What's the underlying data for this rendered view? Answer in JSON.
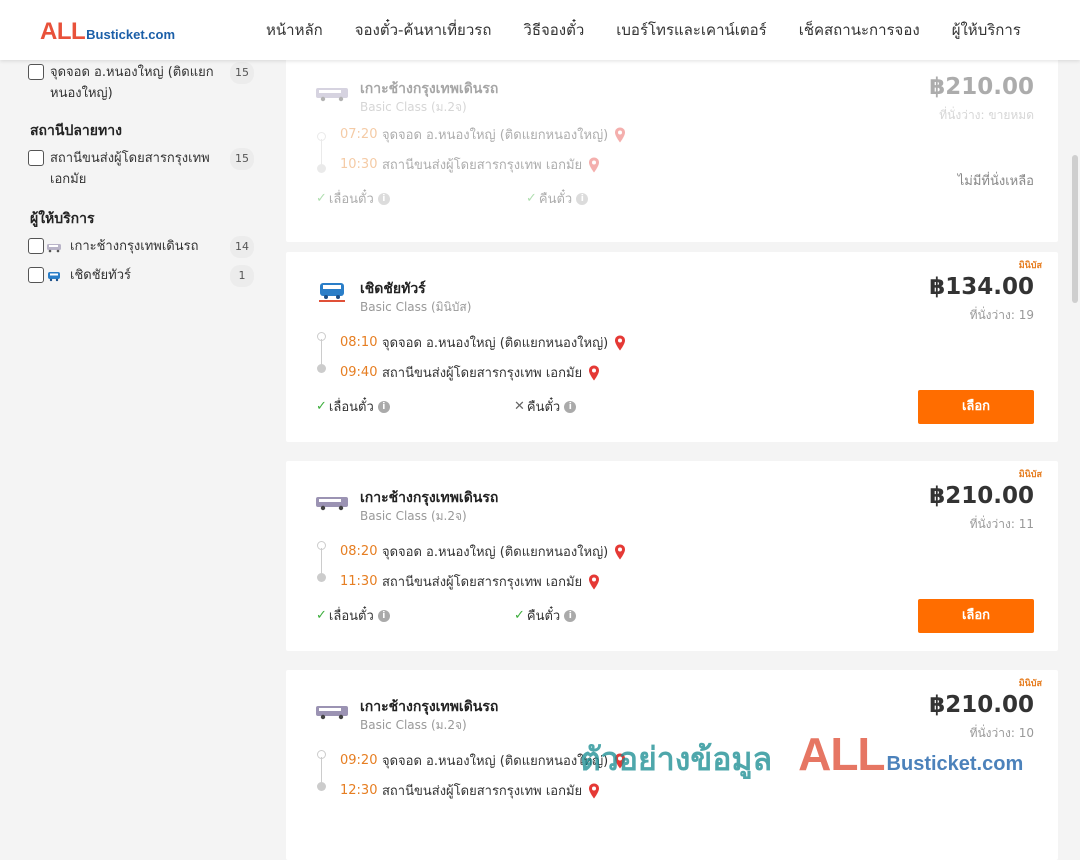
{
  "header": {
    "logo_all": "ALL",
    "logo_rest": "Busticket.com",
    "nav": [
      "หน้าหลัก",
      "จองตั๋ว-ค้นหาเที่ยวรถ",
      "วิธีจองตั๋ว",
      "เบอร์โทรและเคาน์เตอร์",
      "เช็คสถานะการจอง",
      "ผู้ให้บริการ"
    ]
  },
  "sidebar": {
    "origin_items": [
      {
        "label": "จุดจอด อ.หนองใหญ่ (ติดแยกหนองใหญ่)",
        "count": "15"
      }
    ],
    "dest_title": "สถานีปลายทาง",
    "dest_items": [
      {
        "label": "สถานีขนส่งผู้โดยสารกรุงเทพ เอกมัย",
        "count": "15"
      }
    ],
    "operator_title": "ผู้ให้บริการ",
    "operator_items": [
      {
        "label": "เกาะช้างกรุงเทพเดินรถ",
        "count": "14"
      },
      {
        "label": "เชิดชัยทัวร์",
        "count": "1"
      }
    ]
  },
  "cards": [
    {
      "operator": "เกาะช้างกรุงเทพเดินรถ",
      "class": "Basic Class (ม.2จ)",
      "price": "฿210.00",
      "seats": "ที่นั่งว่าง: ขายหมด",
      "dep_time": "07:20",
      "dep_place": "จุดจอด อ.หนองใหญ่ (ติดแยกหนองใหญ่)",
      "arr_time": "10:30",
      "arr_place": "สถานีขนส่งผู้โดยสารกรุงเทพ เอกมัย",
      "feat1": "เลื่อนตั๋ว",
      "feat2": "คืนตั๋ว",
      "status": "ไม่มีที่นั่งเหลือ",
      "badge": ""
    },
    {
      "operator": "เชิดชัยทัวร์",
      "class": "Basic Class (มินิบัส)",
      "price": "฿134.00",
      "seats": "ที่นั่งว่าง: 19",
      "dep_time": "08:10",
      "dep_place": "จุดจอด อ.หนองใหญ่ (ติดแยกหนองใหญ่)",
      "arr_time": "09:40",
      "arr_place": "สถานีขนส่งผู้โดยสารกรุงเทพ เอกมัย",
      "feat1": "เลื่อนตั๋ว",
      "feat2": "คืนตั๋ว",
      "button": "เลือก",
      "badge": "มินิบัส"
    },
    {
      "operator": "เกาะช้างกรุงเทพเดินรถ",
      "class": "Basic Class (ม.2จ)",
      "price": "฿210.00",
      "seats": "ที่นั่งว่าง: 11",
      "dep_time": "08:20",
      "dep_place": "จุดจอด อ.หนองใหญ่ (ติดแยกหนองใหญ่)",
      "arr_time": "11:30",
      "arr_place": "สถานีขนส่งผู้โดยสารกรุงเทพ เอกมัย",
      "feat1": "เลื่อนตั๋ว",
      "feat2": "คืนตั๋ว",
      "button": "เลือก",
      "badge": "มินิบัส"
    },
    {
      "operator": "เกาะช้างกรุงเทพเดินรถ",
      "class": "Basic Class (ม.2จ)",
      "price": "฿210.00",
      "seats": "ที่นั่งว่าง: 10",
      "dep_time": "09:20",
      "dep_place": "จุดจอด อ.หนองใหญ่ (ติดแยกหนองใหญ่)",
      "arr_time": "12:30",
      "arr_place": "สถานีขนส่งผู้โดยสารกรุงเทพ เอกมัย",
      "badge": "มินิบัส"
    }
  ],
  "watermark": {
    "text": "ตัวอย่างข้อมูล",
    "all": "ALL",
    "rest": "Busticket.com"
  },
  "colors": {
    "accent": "#ff6d00",
    "time": "#e67e22",
    "check": "#3dae3d",
    "pin": "#e53935"
  }
}
